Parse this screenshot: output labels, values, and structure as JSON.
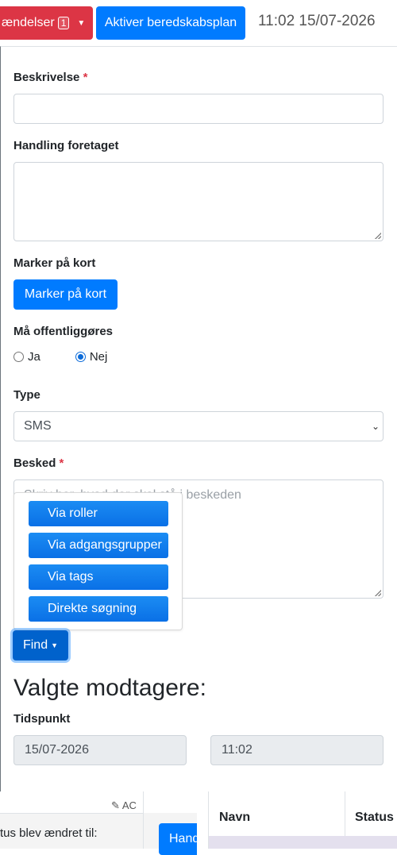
{
  "topbar": {
    "events_label": "ændelser",
    "events_count": "1",
    "activate_plan_label": "Aktiver beredskabsplan",
    "clock": "11:02 15/07-2026"
  },
  "form": {
    "description_label": "Beskrivelse",
    "required_mark": "*",
    "description_value": "",
    "action_label": "Handling foretaget",
    "action_value": "",
    "map_label": "Marker på kort",
    "map_button": "Marker på kort",
    "publish_label": "Må offentliggøres",
    "publish_options": [
      "Ja",
      "Nej"
    ],
    "publish_selected": "Nej",
    "type_label": "Type",
    "type_value": "SMS",
    "message_label": "Besked",
    "message_placeholder": "Skriv her, hvad der skal stå i beskeden"
  },
  "find_menu": {
    "items": [
      "Via roller",
      "Via adgangsgrupper",
      "Via tags",
      "Direkte søgning"
    ],
    "button_label": "Find"
  },
  "recipients": {
    "heading": "Valgte modtagere:",
    "time_label": "Tidspunkt",
    "date_value": "15/07-2026",
    "time_value": "11:02"
  },
  "background": {
    "ac_label": "AC",
    "status_text": "tus blev ændret til:",
    "cut_button": "Hand",
    "col_name": "Navn",
    "col_status": "Status"
  },
  "colors": {
    "danger": "#dc3545",
    "primary": "#007bff",
    "required": "#dc3545"
  }
}
